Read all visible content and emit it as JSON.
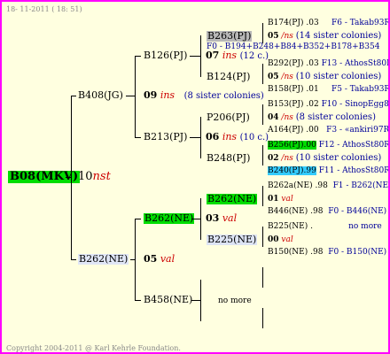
{
  "header": {
    "date": "18- 11-2011 ( 18: 51)"
  },
  "footer": {
    "copyright": "Copyright 2004-2011 @ Karl Kehrle Foundation."
  },
  "root": {
    "id": "B08(MKV)",
    "count": "10",
    "note": "nst"
  },
  "p1": {
    "id": "B408(JG)",
    "count": "09",
    "ins": "ins",
    "note": "(8 sister colonies)"
  },
  "p2": {
    "id": "B262(NE)",
    "count": "05",
    "val": "val"
  },
  "g1": {
    "id": "B126(PJ)",
    "count": "07",
    "ins": "ins",
    "note": "(12 c.)"
  },
  "g2": {
    "id": "B213(PJ)",
    "count": "06",
    "ins": "ins",
    "note": "(10 c.)"
  },
  "g3": {
    "id": "B262(NE)",
    "count": "03",
    "val": "val"
  },
  "g4": {
    "id": "B458(NE)",
    "nomore": "no more"
  },
  "h1": {
    "id": "B263(PJ)",
    "count": "05",
    "ins": "/ns",
    "note": "(14 sister colonies)",
    "line": "F0 - B194+B248+B84+B352+B178+B354"
  },
  "h2": {
    "id": "B124(PJ)",
    "count": "05",
    "ins": "/ns",
    "note": "(10 sister colonies)"
  },
  "h3": {
    "id": "P206(PJ)",
    "count": "04",
    "ins": "/ns",
    "note": "(8 sister colonies)"
  },
  "h4": {
    "id": "B248(PJ)",
    "count": "02",
    "ins": "/ns",
    "note": "(10 sister colonies)"
  },
  "h5": {
    "id": "B262(NE)",
    "count": "01",
    "val": "val"
  },
  "h6": {
    "id": "B225(NE)",
    "count": "00",
    "val": "val"
  },
  "rows": [
    {
      "id": "B174(PJ)",
      "num": ".03",
      "line": "F6 - Takab93R"
    },
    {
      "id": "B292(PJ)",
      "num": ".03",
      "line": "F13 - AthosSt80R"
    },
    {
      "id": "B158(PJ)",
      "num": ".01",
      "line": "F5 - Takab93R"
    },
    {
      "id": "B153(PJ)",
      "num": ".02",
      "line": "F10 - SinopEgg86R"
    },
    {
      "id": "A164(PJ)",
      "num": ".00",
      "line": "F3 - «ankiri97R"
    },
    {
      "id": "B256(PJ)",
      "num": ".00",
      "line": "F12 - AthosSt80R"
    },
    {
      "id": "B240(PJ)",
      "num": ".99",
      "line": "F11 - AthosSt80R"
    },
    {
      "id": "B262a(NE)",
      "num": ".98",
      "line": "F1 - B262(NE)"
    },
    {
      "id": "B446(NE)",
      "num": ".98",
      "line": "F0 - B446(NE)"
    },
    {
      "id": "B225(NE)",
      "num": ".",
      "line": "no more"
    },
    {
      "id": "B150(NE)",
      "num": ".98",
      "line": "F0 - B150(NE)"
    }
  ]
}
